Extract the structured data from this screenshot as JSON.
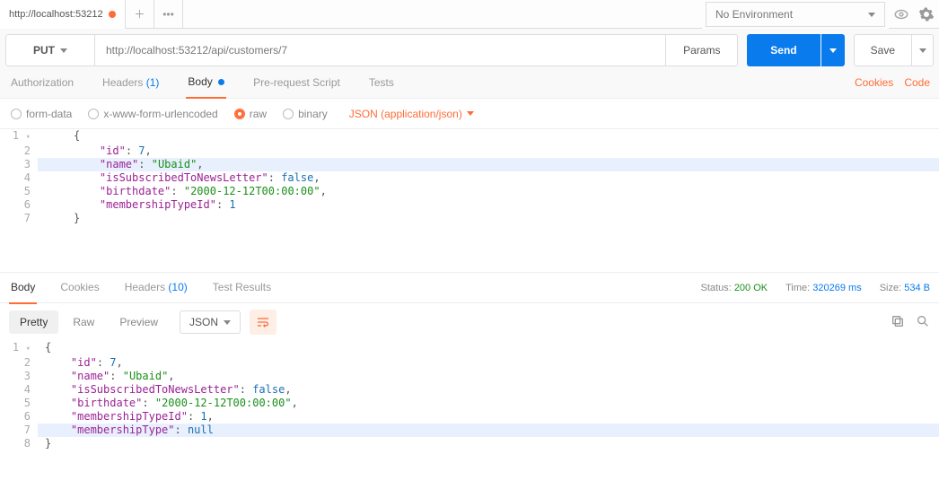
{
  "topbar": {
    "tab_label": "http://localhost:53212",
    "env_label": "No Environment"
  },
  "request": {
    "method": "PUT",
    "url": "http://localhost:53212/api/customers/7",
    "params_btn": "Params",
    "send_btn": "Send",
    "save_btn": "Save"
  },
  "req_tabs": {
    "auth": "Authorization",
    "headers": "Headers",
    "headers_count": "(1)",
    "body": "Body",
    "prereq": "Pre-request Script",
    "tests": "Tests",
    "cookies_link": "Cookies",
    "code_link": "Code"
  },
  "body_opts": {
    "formdata": "form-data",
    "urlenc": "x-www-form-urlencoded",
    "raw": "raw",
    "binary": "binary",
    "json_type": "JSON (application/json)"
  },
  "req_body_lines": [
    {
      "n": "1",
      "html": "<span class='p'>{</span>",
      "fold": "▾"
    },
    {
      "n": "2",
      "html": "    <span class='k'>\"id\"</span><span class='p'>: </span><span class='n'>7</span><span class='p'>,</span>"
    },
    {
      "n": "3",
      "html": "    <span class='k'>\"name\"</span><span class='p'>: </span><span class='s'>\"Ubaid\"</span><span class='p'>,</span>",
      "hl": true
    },
    {
      "n": "4",
      "html": "    <span class='k'>\"isSubscribedToNewsLetter\"</span><span class='p'>: </span><span class='b'>false</span><span class='p'>,</span>"
    },
    {
      "n": "5",
      "html": "    <span class='k'>\"birthdate\"</span><span class='p'>: </span><span class='s'>\"2000-12-12T00:00:00\"</span><span class='p'>,</span>"
    },
    {
      "n": "6",
      "html": "    <span class='k'>\"membershipTypeId\"</span><span class='p'>: </span><span class='n'>1</span>"
    },
    {
      "n": "7",
      "html": "<span class='p'>}</span>"
    }
  ],
  "resp_tabs": {
    "body": "Body",
    "cookies": "Cookies",
    "headers": "Headers",
    "headers_count": "(10)",
    "tests": "Test Results"
  },
  "resp_meta": {
    "status_label": "Status:",
    "status_val": "200 OK",
    "time_label": "Time:",
    "time_val": "320269 ms",
    "size_label": "Size:",
    "size_val": "534 B"
  },
  "resp_toolbar": {
    "pretty": "Pretty",
    "raw": "Raw",
    "preview": "Preview",
    "json": "JSON"
  },
  "resp_body_lines": [
    {
      "n": "1",
      "html": "<span class='p'>{</span>",
      "fold": "▾"
    },
    {
      "n": "2",
      "html": "    <span class='k'>\"id\"</span><span class='p'>: </span><span class='n'>7</span><span class='p'>,</span>"
    },
    {
      "n": "3",
      "html": "    <span class='k'>\"name\"</span><span class='p'>: </span><span class='s'>\"Ubaid\"</span><span class='p'>,</span>"
    },
    {
      "n": "4",
      "html": "    <span class='k'>\"isSubscribedToNewsLetter\"</span><span class='p'>: </span><span class='b'>false</span><span class='p'>,</span>"
    },
    {
      "n": "5",
      "html": "    <span class='k'>\"birthdate\"</span><span class='p'>: </span><span class='s'>\"2000-12-12T00:00:00\"</span><span class='p'>,</span>"
    },
    {
      "n": "6",
      "html": "    <span class='k'>\"membershipTypeId\"</span><span class='p'>: </span><span class='n'>1</span><span class='p'>,</span>"
    },
    {
      "n": "7",
      "html": "    <span class='k'>\"membershipType\"</span><span class='p'>: </span><span class='b'>null</span>",
      "hl": true
    },
    {
      "n": "8",
      "html": "<span class='p'>}</span>"
    }
  ]
}
